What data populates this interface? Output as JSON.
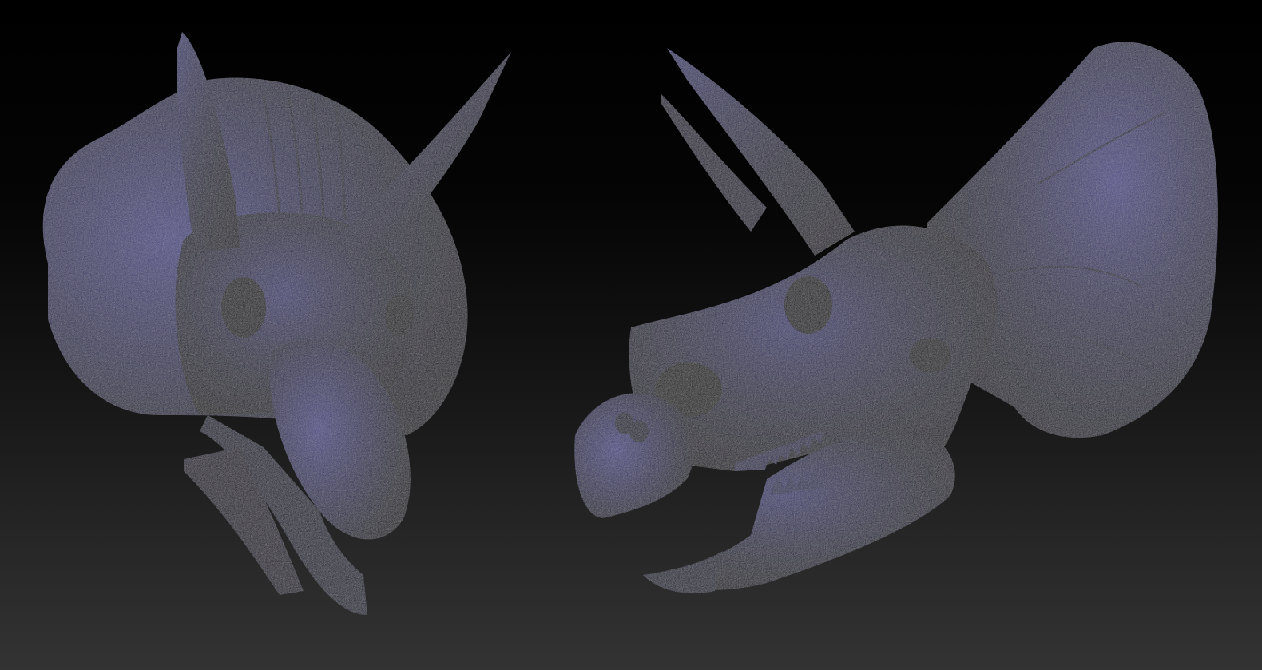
{
  "scene": {
    "background_top": "#000000",
    "background_bottom": "#333333",
    "material_base": "#1c1a33",
    "material_highlight": "#6a66b4",
    "material_shadow": "#0a0916",
    "models": [
      {
        "name": "triceratops-skull-front-view",
        "icon": "skull-sculpt"
      },
      {
        "name": "triceratops-skull-side-view",
        "icon": "skull-sculpt"
      }
    ]
  }
}
